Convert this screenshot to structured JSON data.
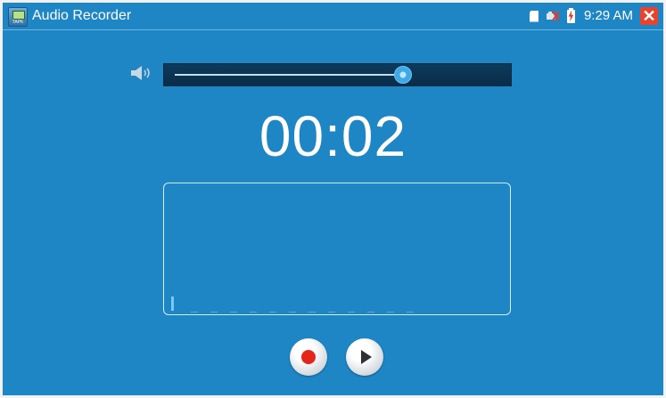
{
  "app": {
    "title": "Audio Recorder",
    "icon": "app-logo-icon",
    "icon_text": "TAPK"
  },
  "status": {
    "time": "9:29 AM",
    "icons": [
      "sd-card-icon",
      "network-disconnected-icon",
      "battery-charging-icon",
      "close-icon"
    ],
    "close_label": "✕"
  },
  "volume": {
    "icon": "speaker-icon",
    "level": 0.7
  },
  "recorder": {
    "elapsed": "00:02"
  },
  "controls": {
    "record": "record-icon",
    "play": "play-icon"
  },
  "colors": {
    "background": "#1f86c6",
    "record": "#e5261a",
    "close": "#e8432e"
  }
}
